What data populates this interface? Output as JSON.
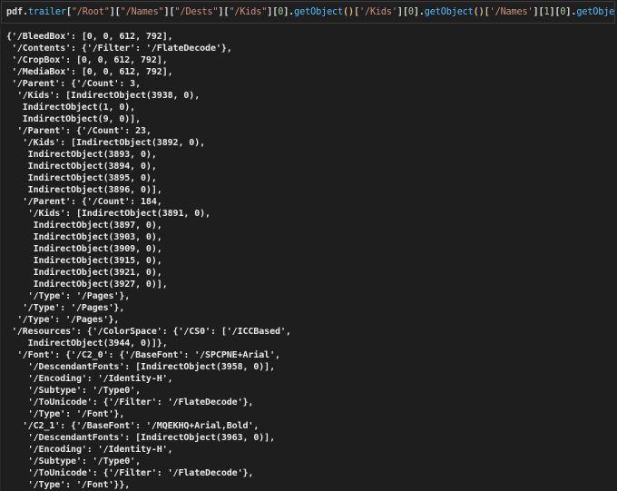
{
  "input": {
    "tokens": [
      {
        "t": "pdf",
        "c": "var"
      },
      {
        "t": ".",
        "c": "punc"
      },
      {
        "t": "trailer",
        "c": "attr"
      },
      {
        "t": "[",
        "c": "punc"
      },
      {
        "t": "\"/Root\"",
        "c": "str"
      },
      {
        "t": "][",
        "c": "punc"
      },
      {
        "t": "\"/Names\"",
        "c": "str"
      },
      {
        "t": "][",
        "c": "punc"
      },
      {
        "t": "\"/Dests\"",
        "c": "str"
      },
      {
        "t": "][",
        "c": "punc"
      },
      {
        "t": "\"/Kids\"",
        "c": "str"
      },
      {
        "t": "][",
        "c": "punc"
      },
      {
        "t": "0",
        "c": "num"
      },
      {
        "t": "].",
        "c": "punc"
      },
      {
        "t": "getObject",
        "c": "fn"
      },
      {
        "t": "()[",
        "c": "paren"
      },
      {
        "t": "'/Kids'",
        "c": "str"
      },
      {
        "t": "][",
        "c": "punc"
      },
      {
        "t": "0",
        "c": "num"
      },
      {
        "t": "].",
        "c": "punc"
      },
      {
        "t": "getObject",
        "c": "fn"
      },
      {
        "t": "()[",
        "c": "paren"
      },
      {
        "t": "'/Names'",
        "c": "str"
      },
      {
        "t": "][",
        "c": "punc"
      },
      {
        "t": "1",
        "c": "num"
      },
      {
        "t": "][",
        "c": "punc"
      },
      {
        "t": "0",
        "c": "num"
      },
      {
        "t": "].",
        "c": "punc"
      },
      {
        "t": "getObject",
        "c": "fn"
      },
      {
        "t": "()",
        "c": "paren"
      }
    ]
  },
  "output": {
    "lines": [
      "{'/BleedBox': [0, 0, 612, 792],",
      " '/Contents': {'/Filter': '/FlateDecode'},",
      " '/CropBox': [0, 0, 612, 792],",
      " '/MediaBox': [0, 0, 612, 792],",
      " '/Parent': {'/Count': 3,",
      "  '/Kids': [IndirectObject(3938, 0),",
      "   IndirectObject(1, 0),",
      "   IndirectObject(9, 0)],",
      "  '/Parent': {'/Count': 23,",
      "   '/Kids': [IndirectObject(3892, 0),",
      "    IndirectObject(3893, 0),",
      "    IndirectObject(3894, 0),",
      "    IndirectObject(3895, 0),",
      "    IndirectObject(3896, 0)],",
      "   '/Parent': {'/Count': 184,",
      "    '/Kids': [IndirectObject(3891, 0),",
      "     IndirectObject(3897, 0),",
      "     IndirectObject(3903, 0),",
      "     IndirectObject(3909, 0),",
      "     IndirectObject(3915, 0),",
      "     IndirectObject(3921, 0),",
      "     IndirectObject(3927, 0)],",
      "    '/Type': '/Pages'},",
      "   '/Type': '/Pages'},",
      "  '/Type': '/Pages'},",
      " '/Resources': {'/ColorSpace': {'/CS0': ['/ICCBased',",
      "    IndirectObject(3944, 0)]},",
      "  '/Font': {'/C2_0': {'/BaseFont': '/SPCPNE+Arial',",
      "    '/DescendantFonts': [IndirectObject(3958, 0)],",
      "    '/Encoding': '/Identity-H',",
      "    '/Subtype': '/Type0',",
      "    '/ToUnicode': {'/Filter': '/FlateDecode'},",
      "    '/Type': '/Font'},",
      "   '/C2_1': {'/BaseFont': '/MQEKHQ+Arial,Bold',",
      "    '/DescendantFonts': [IndirectObject(3963, 0)],",
      "    '/Encoding': '/Identity-H',",
      "    '/Subtype': '/Type0',",
      "    '/ToUnicode': {'/Filter': '/FlateDecode'},",
      "    '/Type': '/Font'}},"
    ]
  }
}
